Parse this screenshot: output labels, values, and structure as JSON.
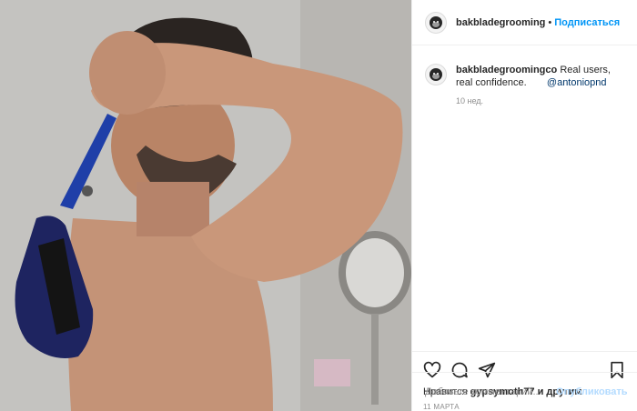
{
  "post": {
    "header": {
      "username": "bakbladegrooming",
      "separator": "•",
      "follow_label": "Подписаться"
    },
    "caption": {
      "username": "bakbladegroomingco",
      "text": "Real users, real confidence. ⠀⠀",
      "mention": "@antoniopnd",
      "time_ago": "10 нед."
    },
    "actions": {
      "icons": [
        "heart-icon",
        "comment-icon",
        "share-icon",
        "bookmark-icon"
      ]
    },
    "likes": {
      "prefix": "Нравится",
      "user": "gypsymoth77",
      "suffix": "и другим"
    },
    "date": "11 МАРТА",
    "add_comment": {
      "placeholder": "Добавьте комментарий...",
      "post_label": "Опубликовать"
    },
    "colors": {
      "follow": "#0095f6",
      "post_disabled": "#b3dbff",
      "blade_blue": "#1f3fa8"
    }
  }
}
